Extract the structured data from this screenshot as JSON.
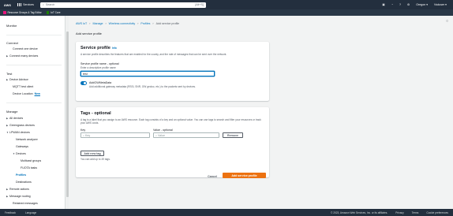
{
  "topbar": {
    "logo": "aws",
    "services_label": "Services",
    "search_placeholder": "Search",
    "search_shortcut": "[Alt+S]",
    "region": "Oregon ▾",
    "account": "Vsduser ▾"
  },
  "favorites": [
    {
      "label": "Resource Groups & Tag Editor",
      "color": "#e7157b"
    },
    {
      "label": "IoT Core",
      "color": "#1d8102"
    }
  ],
  "sidebar": {
    "sections": [
      {
        "title": "Monitor",
        "items": []
      },
      {
        "title": "Connect",
        "items": [
          "Connect one device",
          "Connect many devices"
        ]
      },
      {
        "title": "Test",
        "items": [
          "Device Advisor",
          "MQTT test client",
          "Device Location"
        ]
      },
      {
        "title": "Manage",
        "items": [
          "All devices",
          "Greengrass devices",
          "LPWAN devices",
          "Network analyzer",
          "Gateways",
          "Devices",
          "Multicast groups",
          "FUOTA tasks",
          "Profiles",
          "Destinations",
          "Remote actions",
          "Message routing",
          "Retained messages"
        ]
      }
    ],
    "new_badge": "New"
  },
  "breadcrumb": [
    "AWS IoT",
    "Manage",
    "Wireless connectivity",
    "Profiles",
    "Add service profile"
  ],
  "page_title": "Add service profile",
  "service_profile": {
    "title": "Service profile",
    "info": "Info",
    "description": "A service profile describes the features that are enabled for the county, and the rate of messages that can be sent over the network.",
    "name_label": "Service profile name - optional",
    "name_hint": "Enter a descriptive profile name",
    "name_value": "test",
    "toggle_label": "AddGWMetaData",
    "toggle_desc": "Add additional gateway metadata (RSSI, SNR, GW geoloc, etc.) to the packets sent by devices."
  },
  "tags": {
    "title": "Tags - optional",
    "description": "A tag is a label that you assign to an AWS resource. Each tag consists of a key and an optional value. You can use tags to search and filter your resources or track your AWS costs.",
    "key_label": "Key",
    "value_label": "Value - optional",
    "key_placeholder": "Key",
    "value_placeholder": "Value",
    "remove_label": "Remove",
    "add_label": "Add new tag",
    "limit_text": "You can add up to 49 tags."
  },
  "actions": {
    "cancel": "Cancel",
    "submit": "Add service profile"
  },
  "footer": {
    "feedback": "Feedback",
    "language": "Language",
    "copyright": "© 2023, Amazon Web Services, Inc. or its affiliates.",
    "privacy": "Privacy",
    "terms": "Terms",
    "cookies": "Cookie preferences"
  },
  "colors": {
    "accent": "#0073bb",
    "primary_button": "#ec7211",
    "nav_bg": "#232f3e"
  }
}
